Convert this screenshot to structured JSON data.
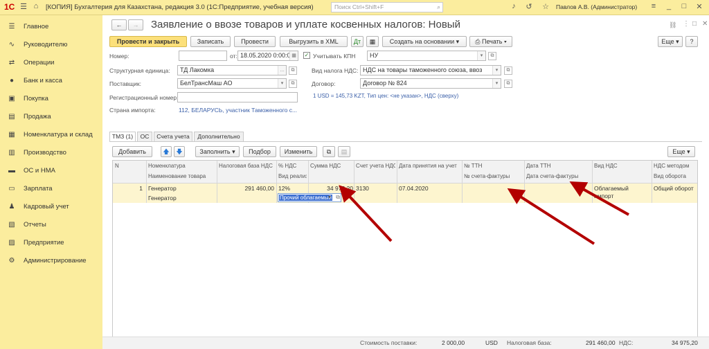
{
  "topbar": {
    "logo": "1С",
    "title": "[КОПИЯ] Бухгалтерия для Казахстана, редакция 3.0  (1С:Предприятие, учебная версия)",
    "search_placeholder": "Поиск Ctrl+Shift+F",
    "user": "Павлов А.В. (Администратор)"
  },
  "sidebar": {
    "items": [
      {
        "label": "Главное",
        "icon": "☰"
      },
      {
        "label": "Руководителю",
        "icon": "∿"
      },
      {
        "label": "Операции",
        "icon": "⇄"
      },
      {
        "label": "Банк и касса",
        "icon": "●"
      },
      {
        "label": "Покупка",
        "icon": "▣"
      },
      {
        "label": "Продажа",
        "icon": "▤"
      },
      {
        "label": "Номенклатура и склад",
        "icon": "▦"
      },
      {
        "label": "Производство",
        "icon": "▥"
      },
      {
        "label": "ОС и НМА",
        "icon": "▬"
      },
      {
        "label": "Зарплата",
        "icon": "▭"
      },
      {
        "label": "Кадровый учет",
        "icon": "♟"
      },
      {
        "label": "Отчеты",
        "icon": "▧"
      },
      {
        "label": "Предприятие",
        "icon": "▨"
      },
      {
        "label": "Администрирование",
        "icon": "⚙"
      }
    ]
  },
  "doc": {
    "title": "Заявление о ввозе товаров и уплате косвенных налогов: Новый"
  },
  "toolbar": {
    "post_close": "Провести и закрыть",
    "save": "Записать",
    "post": "Провести",
    "export_xml": "Выгрузить в XML",
    "create_based": "Создать на основании",
    "print": "Печать",
    "more": "Еще",
    "help": "?"
  },
  "form": {
    "number_label": "Номер:",
    "number_value": "",
    "date_label": "от:",
    "date_value": "18.05.2020  0:00:0",
    "kpn_label": "Учитывать КПН",
    "kpn_value": "НУ",
    "unit_label": "Структурная единица:",
    "unit_value": "ТД Лакомка",
    "vat_type_label": "Вид налога НДС:",
    "vat_type_value": "НДС на товары таможенного союза, ввоз",
    "supplier_label": "Поставщик:",
    "supplier_value": "БелТрансМаш АО",
    "contract_label": "Договор:",
    "contract_value": "Договор № 824",
    "reg_label": "Регистрационный номер:",
    "reg_value": "",
    "rate_info": "1 USD = 145,73 KZT, Тип цен: <не указан>, НДС (сверху)",
    "country_label": "Страна импорта:",
    "country_value": "112, БЕЛАРУСЬ, участник Таможенного с..."
  },
  "tabs": [
    "ТМЗ (1)",
    "ОС",
    "Счета учета",
    "Дополнительно"
  ],
  "table_toolbar": {
    "add": "Добавить",
    "fill": "Заполнить",
    "selection": "Подбор",
    "change": "Изменить",
    "more": "Еще"
  },
  "table": {
    "headers1": [
      "N",
      "Номенклатура",
      "Налоговая база НДС",
      "% НДС",
      "Сумма НДС",
      "Счет учета НДС",
      "Дата принятия на учет",
      "№ ТТН",
      "Дата ТТН",
      "Вид НДС",
      "НДС методом"
    ],
    "headers2": [
      "",
      "Наименование товара",
      "",
      "Вид реализации (НДС)",
      "",
      "",
      "",
      "№ счета-фактуры",
      "Дата счета-фактуры",
      "",
      "Вид оборота"
    ],
    "rows": [
      {
        "n": "1",
        "item": "Генератор",
        "item_name": "Генератор",
        "base": "291 460,00",
        "rate": "12%",
        "vat_sum": "34 975,20",
        "account": "3130",
        "date": "07.04.2020",
        "vat_kind": "Облагаемый импорт",
        "method": "Общий оборот",
        "realization": "Прочий облагаемый"
      }
    ]
  },
  "footer": {
    "cost_label": "Стоимость поставки:",
    "cost_value": "2 000,00",
    "currency": "USD",
    "base_label": "Налоговая база:",
    "base_value": "291 460,00",
    "vat_label": "НДС:",
    "vat_value": "34 975,20"
  },
  "colors": {
    "accent": "#fce07a",
    "sidebar": "#fbed9e",
    "arrow": "#b30000",
    "highlight": "#fdf5cf"
  }
}
